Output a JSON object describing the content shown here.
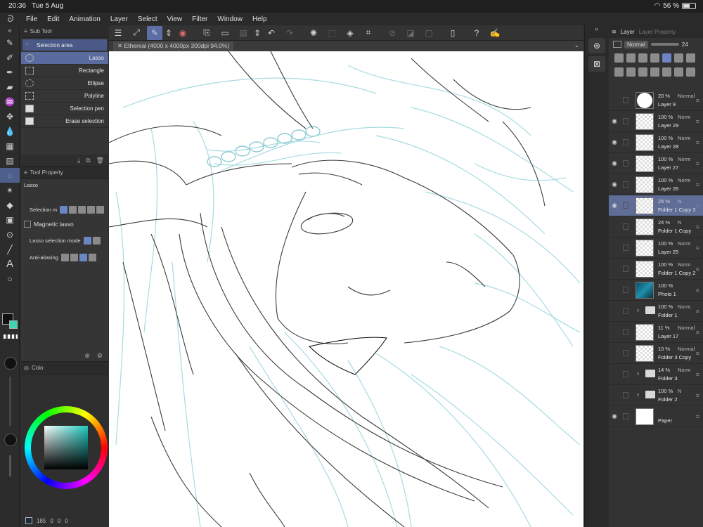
{
  "status": {
    "time": "20:36",
    "date": "Tue 5 Aug",
    "battery": "56 %",
    "battery_level": 0.56
  },
  "menu": [
    "File",
    "Edit",
    "Animation",
    "Layer",
    "Select",
    "View",
    "Filter",
    "Window",
    "Help"
  ],
  "subtool": {
    "title": "Sub Tool",
    "group": "Selection area",
    "items": [
      {
        "label": "Lasso",
        "icon": "lasso-icon",
        "active": true
      },
      {
        "label": "Rectangle",
        "icon": "rectangle-select-icon",
        "active": false
      },
      {
        "label": "Ellipse",
        "icon": "ellipse-select-icon",
        "active": false
      },
      {
        "label": "Polyline",
        "icon": "polyline-icon",
        "active": false
      },
      {
        "label": "Selection pen",
        "icon": "selection-pen-icon",
        "active": false
      },
      {
        "label": "Erase selection",
        "icon": "erase-selection-icon",
        "active": false
      }
    ]
  },
  "toolprop": {
    "title": "Tool Property",
    "tool_name": "Lasso",
    "selection_mode_label": "Selection m",
    "magnetic_label": "Magnetic lasso",
    "lasso_mode_label": "Lasso selection mode",
    "antialias_label": "Anti-aliasing"
  },
  "color": {
    "tab": "Colo",
    "main_color": "#111111",
    "sub_color": "#3cd6b4",
    "brush_size": "185",
    "foot_values": [
      "0",
      "0",
      "0"
    ]
  },
  "canvas": {
    "tab_title": "Ethereal (4000 x 4000px 300dpi 94.0%)"
  },
  "layer_panel": {
    "tab_layer": "Layer",
    "tab_property": "Layer Property",
    "blend": "Normal",
    "opacity": "24",
    "layers": [
      {
        "opacity": "20 %",
        "blend": "Normal",
        "name": "Layer 9",
        "visible": false,
        "thumb": "circle",
        "selected": false,
        "folder": false
      },
      {
        "opacity": "100 %",
        "blend": "Norm",
        "name": "Layer 29",
        "visible": true,
        "thumb": "checker",
        "selected": false,
        "folder": false
      },
      {
        "opacity": "100 %",
        "blend": "Norm",
        "name": "Layer 28",
        "visible": true,
        "thumb": "checker",
        "selected": false,
        "folder": false
      },
      {
        "opacity": "100 %",
        "blend": "Norm",
        "name": "Layer 27",
        "visible": true,
        "thumb": "checker",
        "selected": false,
        "folder": false
      },
      {
        "opacity": "100 %",
        "blend": "Norm",
        "name": "Layer 26",
        "visible": true,
        "thumb": "checker",
        "selected": false,
        "folder": false
      },
      {
        "opacity": "24 %",
        "blend": "N",
        "name": "Folder 1 Copy 3",
        "visible": true,
        "thumb": "checker",
        "selected": true,
        "folder": false
      },
      {
        "opacity": "24 %",
        "blend": "N",
        "name": "Folder 1 Copy",
        "visible": false,
        "thumb": "checker",
        "selected": false,
        "folder": false
      },
      {
        "opacity": "100 %",
        "blend": "Norm",
        "name": "Layer 25",
        "visible": false,
        "thumb": "checker",
        "selected": false,
        "folder": false
      },
      {
        "opacity": "100 %",
        "blend": "Norm",
        "name": "Folder 1 Copy 2",
        "visible": false,
        "thumb": "checker",
        "selected": false,
        "folder": false
      },
      {
        "opacity": "100 %",
        "blend": "",
        "name": "Photo 1",
        "visible": false,
        "thumb": "photo",
        "selected": false,
        "folder": false
      },
      {
        "opacity": "100 %",
        "blend": "Norm",
        "name": "Folder 1",
        "visible": false,
        "thumb": "",
        "selected": false,
        "folder": true
      },
      {
        "opacity": "11 %",
        "blend": "Normal",
        "name": "Layer 17",
        "visible": false,
        "thumb": "checker",
        "selected": false,
        "folder": false
      },
      {
        "opacity": "10 %",
        "blend": "Normal",
        "name": "Folder 3 Copy",
        "visible": false,
        "thumb": "checker",
        "selected": false,
        "folder": false
      },
      {
        "opacity": "14 %",
        "blend": "Norm",
        "name": "Folder 3",
        "visible": false,
        "thumb": "",
        "selected": false,
        "folder": true
      },
      {
        "opacity": "100 %",
        "blend": "N",
        "name": "Folder 2",
        "visible": false,
        "thumb": "",
        "selected": false,
        "folder": true
      },
      {
        "opacity": "",
        "blend": "",
        "name": "Paper",
        "visible": true,
        "thumb": "paper",
        "selected": false,
        "folder": false
      }
    ]
  },
  "colors": {
    "accent": "#5a6ba0",
    "sketch_blue": "#9fd6dd",
    "line": "#3a3a3a"
  }
}
